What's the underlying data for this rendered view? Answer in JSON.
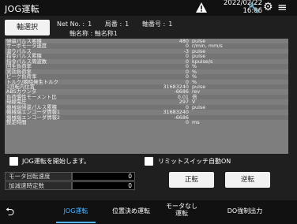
{
  "header": {
    "title": "JOG運転",
    "date": "2022/02/22",
    "time": "16:06"
  },
  "axis": {
    "select_label": "軸選択",
    "net_no_label": "Net No. :",
    "net_no_value": "1",
    "station_label": "局番 :",
    "station_value": "1",
    "axis_no_label": "軸番号 :",
    "axis_no_value": "1",
    "axis_name_label": "軸名称 :",
    "axis_name_value": "軸名称1"
  },
  "monitor": [
    {
      "label": "帰還パルス累積",
      "value": "480",
      "unit": "pulse"
    },
    {
      "label": "サーボモータ速度",
      "value": "0",
      "unit": "r/min, mm/s"
    },
    {
      "label": "溜りパルス",
      "value": "-3",
      "unit": "pulse"
    },
    {
      "label": "指令パルス累積",
      "value": "0",
      "unit": "pulse"
    },
    {
      "label": "指令パルス周波数",
      "value": "0",
      "unit": "kpulse/s"
    },
    {
      "label": "回生負荷率",
      "value": "0",
      "unit": "%"
    },
    {
      "label": "実効負荷率",
      "value": "0",
      "unit": "%"
    },
    {
      "label": "ピーク負荷率",
      "value": "0",
      "unit": "%"
    },
    {
      "label": "トルク/瞬時発生トルク",
      "value": "0",
      "unit": "%"
    },
    {
      "label": "1回転内位置",
      "value": "31683240",
      "unit": "pulse"
    },
    {
      "label": "ABSカウンタ",
      "value": "-6686",
      "unit": "rev"
    },
    {
      "label": "負荷慣性モーメント比",
      "value": "0.01",
      "unit": "倍"
    },
    {
      "label": "母線電圧",
      "value": "297",
      "unit": "V"
    },
    {
      "label": "機械端帰還パルス累積",
      "value": "0",
      "unit": "pulse"
    },
    {
      "label": "機械端エンコーダ情報1",
      "value": "31683240",
      "unit": ""
    },
    {
      "label": "機械端エンコーダ情報2",
      "value": "-6686",
      "unit": ""
    },
    {
      "label": "整定時間",
      "value": "0",
      "unit": "ms"
    }
  ],
  "options": {
    "start_jog_label": "JOG運転を開始します。",
    "limit_auto_on_label": "リミットスイッチ自動ON"
  },
  "params": {
    "motor_speed_label": "モータ回転速度",
    "motor_speed_value": "0",
    "accel_label": "加減速時定数",
    "accel_value": "0"
  },
  "buttons": {
    "forward": "正転",
    "reverse": "逆転"
  },
  "footer": {
    "tab_jog": "JOG運転",
    "tab_positioning": "位置決め運転",
    "tab_motorless_line1": "モータなし",
    "tab_motorless_line2": "運転",
    "tab_do_output": "DO強制出力"
  }
}
